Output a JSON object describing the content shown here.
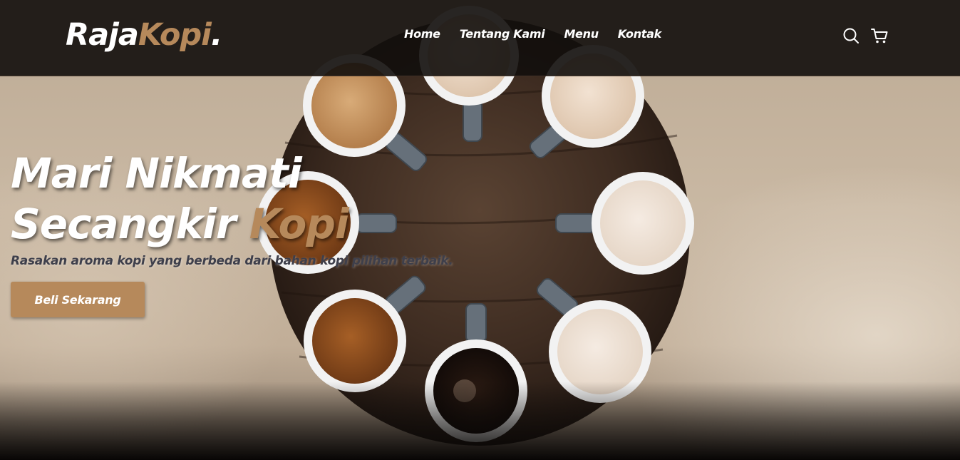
{
  "brand": {
    "name_main": "Raja",
    "name_accent": "Kopi",
    "name_dot": "."
  },
  "nav": {
    "links": [
      "Home",
      "Tentang Kami",
      "Menu",
      "Kontak"
    ],
    "icons": [
      "search-icon",
      "shopping-cart-icon"
    ]
  },
  "hero": {
    "title_line1": "Mari Nikmati",
    "title_line2_main": "Secangkir",
    "title_line2_accent": "Kopi",
    "subtitle": "Rasakan aroma kopi yang berbeda dari bahan kopi pilihan terbaik.",
    "cta_label": "Beli Sekarang"
  },
  "colors": {
    "accent": "#b6895b",
    "navbar_bg": "#120e0c",
    "text_light": "#ffffff",
    "subtitle_text": "#3e3f4b"
  }
}
